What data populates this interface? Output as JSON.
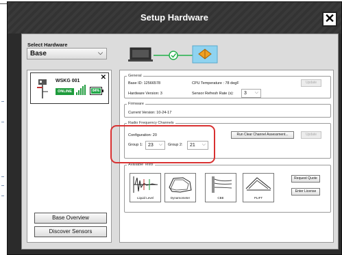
{
  "window": {
    "title": "Setup Hardware"
  },
  "sidebar": {
    "select_label": "Select Hardware",
    "select_value": "Base",
    "device": {
      "name": "WSKG 001",
      "status": "ONLINE",
      "battery": "84%"
    },
    "base_overview_label": "Base Overview",
    "discover_label": "Discover Sensors"
  },
  "general": {
    "legend": "General",
    "base_id": "Base ID: 12566578",
    "cpu_temp": "CPU Temperature : 78 degF",
    "hw_version": "Hardware Version: 3",
    "refresh_label": "Sensor Refresh Rate (s):",
    "refresh_value": "3",
    "update_label": "Update"
  },
  "firmware": {
    "legend": "Firmware",
    "current_version": "Current Version: 10-24-17"
  },
  "radio": {
    "legend": "Radio Frequency Channels",
    "configuration": "Configuration: 20",
    "group1_label": "Group 1:",
    "group1_value": "23",
    "group2_label": "Group 2:",
    "group2_value": "21",
    "assess_label": "Run Clear Channel Assessment...",
    "update_label": "Update"
  },
  "tests": {
    "legend": "Available Tests",
    "items": [
      {
        "label": "Liquid Level"
      },
      {
        "label": "Dynamometer"
      },
      {
        "label": "CBE"
      },
      {
        "label": "PLIFT"
      }
    ],
    "request_quote_label": "Request Quote",
    "enter_license_label": "Enter License"
  },
  "colors": {
    "online_green": "#1e9b3c",
    "highlight_red": "#d83030",
    "connection_green": "#22b04a",
    "accent_orange": "#f0a020"
  }
}
